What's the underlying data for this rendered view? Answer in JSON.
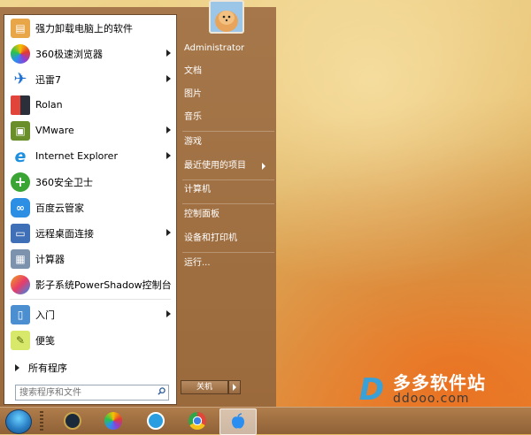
{
  "start_menu": {
    "programs": [
      {
        "label": "强力卸载电脑上的软件",
        "icon": "uninstall-box-icon",
        "has_submenu": false
      },
      {
        "label": "360极速浏览器",
        "icon": "360-browser-icon",
        "has_submenu": true
      },
      {
        "label": "迅雷7",
        "icon": "thunder-bird-icon",
        "has_submenu": true
      },
      {
        "label": "Rolan",
        "icon": "rolan-icon",
        "has_submenu": false
      },
      {
        "label": "VMware",
        "icon": "vmware-icon",
        "has_submenu": true
      },
      {
        "label": "Internet Explorer",
        "icon": "ie-icon",
        "has_submenu": true
      },
      {
        "label": "360安全卫士",
        "icon": "360-safe-icon",
        "has_submenu": false
      },
      {
        "label": "百度云管家",
        "icon": "baidu-cloud-icon",
        "has_submenu": false
      },
      {
        "label": "远程桌面连接",
        "icon": "remote-desktop-icon",
        "has_submenu": true
      },
      {
        "label": "计算器",
        "icon": "calculator-icon",
        "has_submenu": false
      },
      {
        "label": "影子系统PowerShadow控制台",
        "icon": "powershadow-icon",
        "has_submenu": false
      },
      {
        "label": "入门",
        "icon": "getting-started-icon",
        "has_submenu": true
      },
      {
        "label": "便笺",
        "icon": "sticky-notes-icon",
        "has_submenu": false
      }
    ],
    "all_programs": "所有程序",
    "search_placeholder": "搜索程序和文件",
    "right": {
      "user": "Administrator",
      "documents": "文档",
      "pictures": "图片",
      "music": "音乐",
      "games": "游戏",
      "recent": "最近使用的项目",
      "computer": "计算机",
      "control_panel": "控制面板",
      "devices": "设备和打印机",
      "run": "运行..."
    },
    "shutdown": "关机"
  },
  "watermark": {
    "cn": "多多软件站",
    "url": "ddooo.com"
  },
  "taskbar": {
    "items": [
      "lol-client-icon",
      "360-browser-icon",
      "k-app-icon",
      "chrome-icon",
      "apple-icon"
    ]
  },
  "colors": {
    "menu_bg": "#9d6d3f",
    "taskbar_bg": "#a0703f",
    "accent": "#2a7fc4"
  }
}
